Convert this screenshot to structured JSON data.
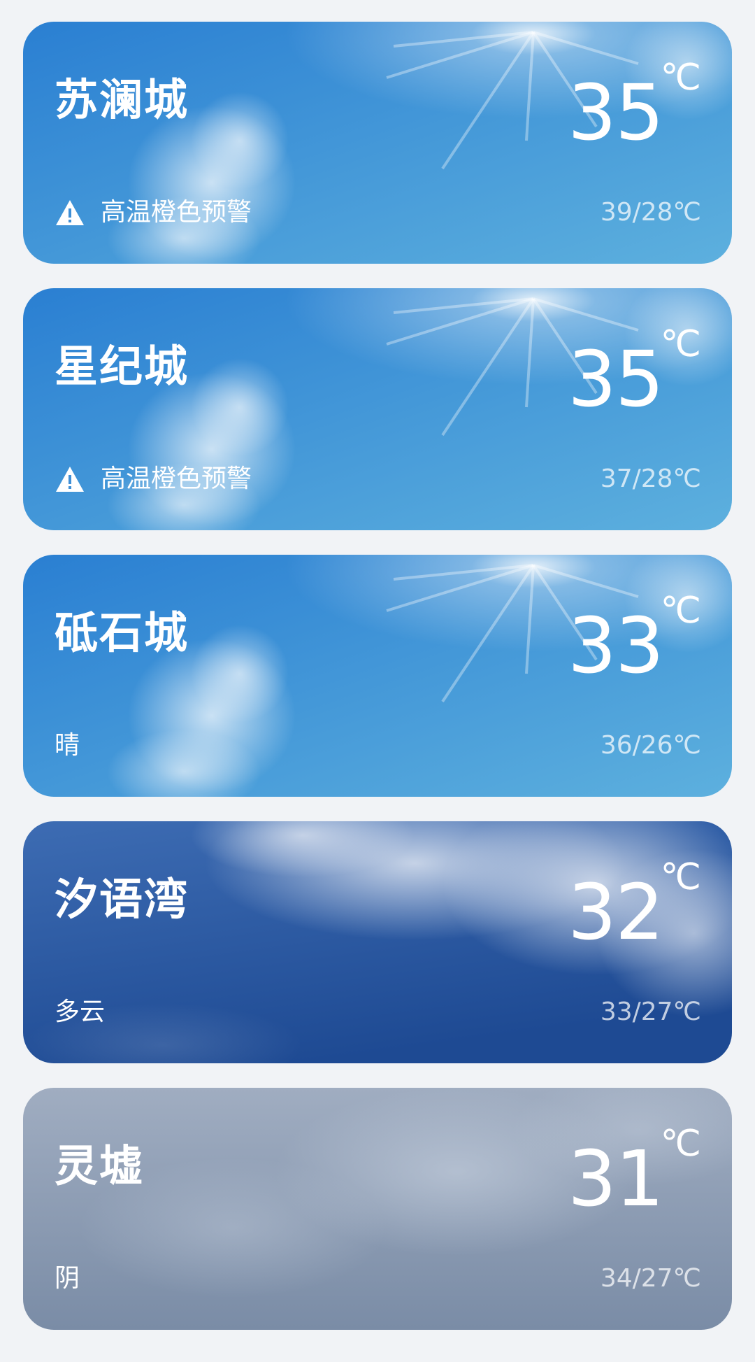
{
  "cards": [
    {
      "city": "苏澜城",
      "temp": "35",
      "unit": "℃",
      "condition": "高温橙色预警",
      "warning": true,
      "range": "39/28℃",
      "background": "sunny",
      "icon": "warning-icon"
    },
    {
      "city": "星纪城",
      "temp": "35",
      "unit": "℃",
      "condition": "高温橙色预警",
      "warning": true,
      "range": "37/28℃",
      "background": "sunny",
      "icon": "warning-icon"
    },
    {
      "city": "砥石城",
      "temp": "33",
      "unit": "℃",
      "condition": "晴",
      "warning": false,
      "range": "36/26℃",
      "background": "sunny"
    },
    {
      "city": "汐语湾",
      "temp": "32",
      "unit": "℃",
      "condition": "多云",
      "warning": false,
      "range": "33/27℃",
      "background": "cloudy"
    },
    {
      "city": "灵墟",
      "temp": "31",
      "unit": "℃",
      "condition": "阴",
      "warning": false,
      "range": "34/27℃",
      "background": "overcast"
    }
  ],
  "colors": {
    "page_background": "#f1f3f6",
    "sunny_top": "#2f86d6",
    "sunny_bottom": "#5aaedd",
    "cloudy_top": "#3b66ad",
    "cloudy_bottom": "#1f4c95",
    "overcast_top": "#9aa8bd",
    "overcast_bottom": "#7d8fa8"
  }
}
